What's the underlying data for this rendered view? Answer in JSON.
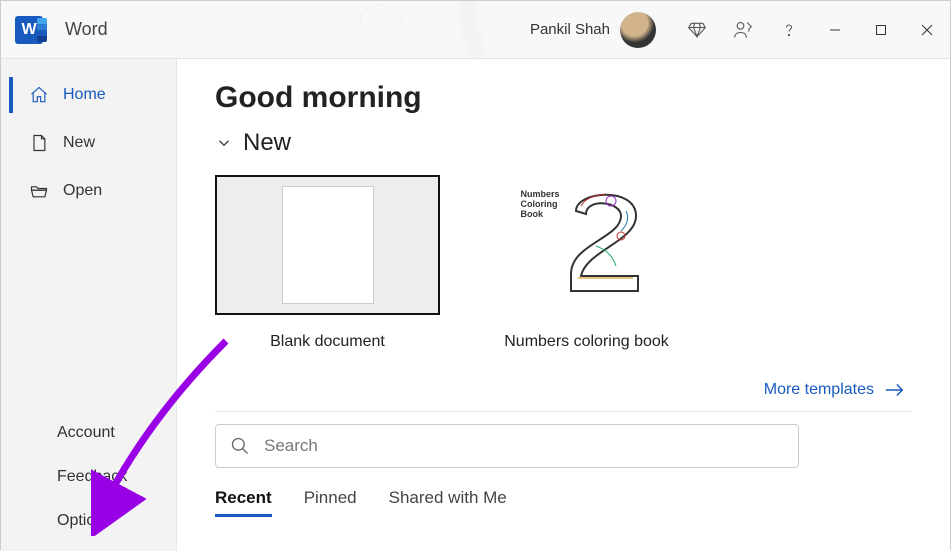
{
  "app": {
    "icon_letter": "W",
    "title": "Word"
  },
  "user": {
    "name": "Pankil Shah"
  },
  "window_controls": {
    "minimize": "minimize",
    "maximize": "maximize",
    "close": "close"
  },
  "sidebar": {
    "top": [
      {
        "id": "home",
        "label": "Home",
        "icon": "home-icon",
        "active": true
      },
      {
        "id": "new",
        "label": "New",
        "icon": "new-doc-icon",
        "active": false
      },
      {
        "id": "open",
        "label": "Open",
        "icon": "folder-open-icon",
        "active": false
      }
    ],
    "bottom": [
      {
        "id": "account",
        "label": "Account"
      },
      {
        "id": "feedback",
        "label": "Feedback"
      },
      {
        "id": "options",
        "label": "Options"
      }
    ]
  },
  "main": {
    "greeting": "Good morning",
    "new_section": {
      "title": "New",
      "templates": [
        {
          "id": "blank",
          "label": "Blank document",
          "selected": true
        },
        {
          "id": "coloring",
          "label": "Numbers coloring book",
          "selected": false,
          "cover_text": "Numbers Coloring Book"
        }
      ],
      "more_link": "More templates"
    },
    "search": {
      "placeholder": "Search",
      "value": ""
    },
    "tabs": [
      {
        "id": "recent",
        "label": "Recent",
        "active": true
      },
      {
        "id": "pinned",
        "label": "Pinned",
        "active": false
      },
      {
        "id": "shared",
        "label": "Shared with Me",
        "active": false
      }
    ]
  },
  "colors": {
    "accent": "#185abd",
    "annotation": "#9a00e6"
  }
}
